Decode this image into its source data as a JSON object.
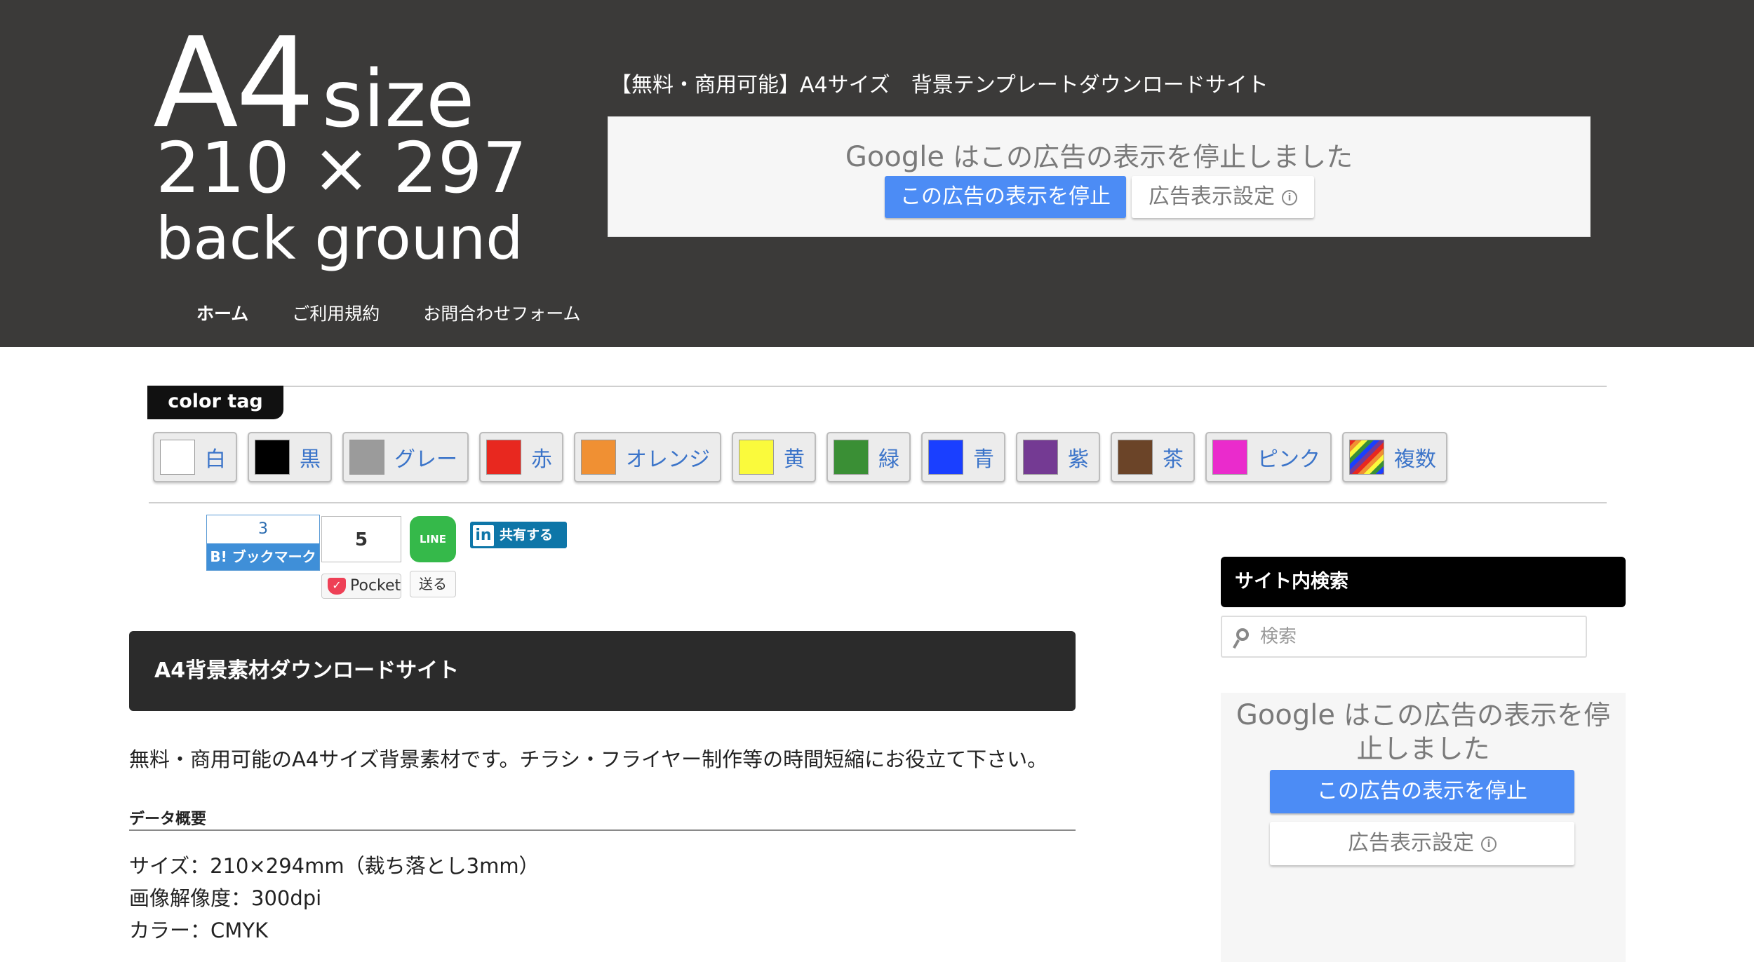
{
  "header": {
    "logo": {
      "line1_big": "A4",
      "line1_small": "size",
      "line2": "210 × 297",
      "line3": "back ground"
    },
    "tagline": "【無料・商用可能】A4サイズ　背景テンプレートダウンロードサイト",
    "ad": {
      "google": "Google",
      "message": "はこの広告の表示を停止しました",
      "stop_label": "この広告の表示を停止",
      "settings_label": "広告表示設定"
    },
    "nav": [
      {
        "label": "ホーム",
        "active": true
      },
      {
        "label": "ご利用規約",
        "active": false
      },
      {
        "label": "お問合わせフォーム",
        "active": false
      }
    ]
  },
  "color_tag": {
    "title": "color tag",
    "swatches": [
      {
        "label": "白",
        "color": "#ffffff"
      },
      {
        "label": "黒",
        "color": "#000000"
      },
      {
        "label": "グレー",
        "color": "#9b9b9b"
      },
      {
        "label": "赤",
        "color": "#e8281f"
      },
      {
        "label": "オレンジ",
        "color": "#f09033"
      },
      {
        "label": "黄",
        "color": "#fafa3c"
      },
      {
        "label": "緑",
        "color": "#3a8f35"
      },
      {
        "label": "青",
        "color": "#1a3fff"
      },
      {
        "label": "紫",
        "color": "#743a93"
      },
      {
        "label": "茶",
        "color": "#6b4428"
      },
      {
        "label": "ピンク",
        "color": "#ea2bcc"
      },
      {
        "label": "複数",
        "color": "multicolor-stripes"
      }
    ]
  },
  "social": {
    "hatena": {
      "count": "3",
      "label": "B! ブックマーク"
    },
    "pocket": {
      "count": "5",
      "label": "Pocket"
    },
    "line": {
      "icon": "LINE",
      "label": "送る"
    },
    "linkedin": {
      "icon": "in",
      "label": "共有する"
    }
  },
  "main": {
    "title": "A4背景素材ダウンロードサイト",
    "intro": "無料・商用可能のA4サイズ背景素材です。チラシ・フライヤー制作等の時間短縮にお役立て下さい。",
    "section_heading": "データ概要",
    "specs": [
      "サイズ：210×294mm（裁ち落とし3mm）",
      "画像解像度：300dpi",
      "カラー：CMYK"
    ]
  },
  "sidebar": {
    "search_heading": "サイト内検索",
    "search_placeholder": "検索",
    "ad": {
      "google": "Google",
      "message": "はこの広告の表示を停止しました",
      "stop_label": "この広告の表示を停止",
      "settings_label": "広告表示設定"
    }
  }
}
